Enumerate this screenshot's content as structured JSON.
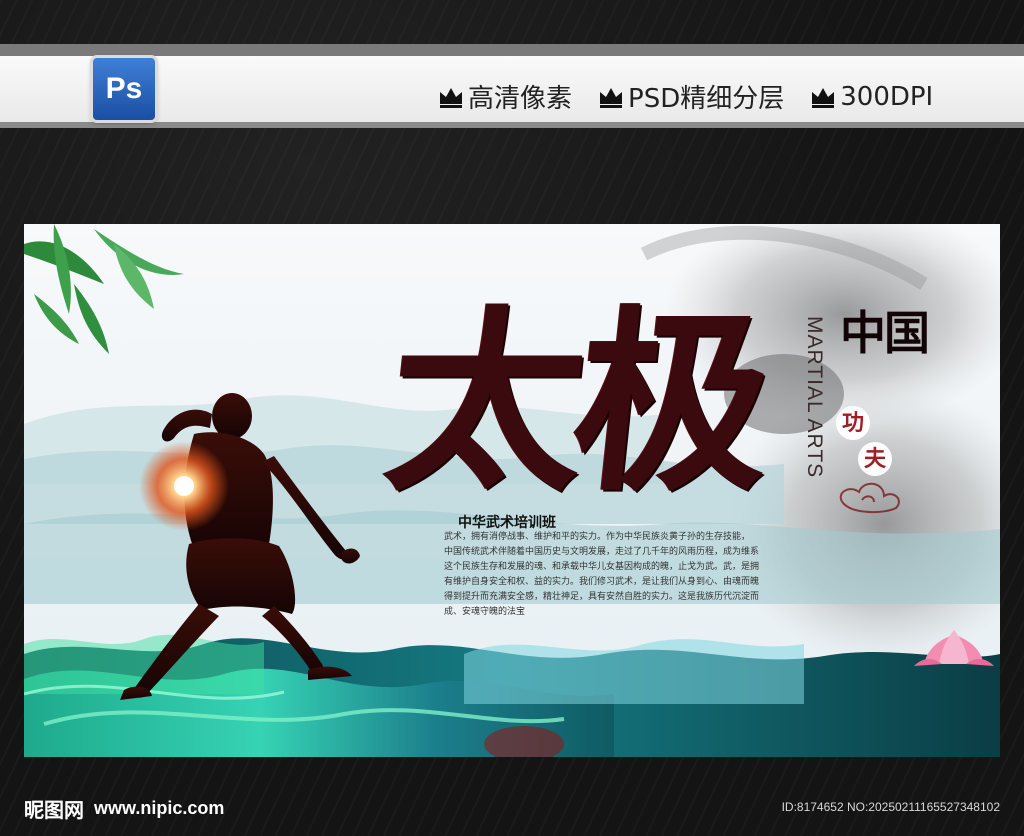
{
  "header": {
    "app_badge": "Ps",
    "features": [
      {
        "icon": "crown-icon",
        "label": "高清像素"
      },
      {
        "icon": "crown-icon",
        "label": "PSD精细分层"
      },
      {
        "icon": "crown-icon",
        "label": "300DPI"
      }
    ]
  },
  "poster": {
    "title": "太极",
    "china": "中国",
    "martial_arts": "MARTIAL ARTS",
    "kungfu": [
      "功",
      "夫"
    ],
    "subtitle": "中华武术培训班",
    "paragraph_lines": [
      "武术，拥有消停战事、维护和平的实力。作为中华民族炎黄子孙的生存技能，",
      "中国传统武术伴随着中国历史与文明发展，走过了几千年的风雨历程，成为维系",
      "这个民族生存和发展的魂、和承载中华儿女基因构成的魄，止戈为武。武，是拥",
      "有维护自身安全和权、益的实力。我们修习武术，是让我们从身到心、由魂而魄",
      "得到提升而充满安全感，精壮神足，具有安然自胜的实力。这是我族历代沉淀而",
      "成、安魂守魄的法宝"
    ]
  },
  "footer": {
    "brand": "昵图网",
    "url": "www.nipic.com",
    "id_text": "ID:8174652 NO:20250211165527348102"
  },
  "colors": {
    "title": "#3b0a0e",
    "kungfu_red": "#9e1f25",
    "water_teal": "#1f8f8a",
    "water_green": "#3fe0a0"
  }
}
